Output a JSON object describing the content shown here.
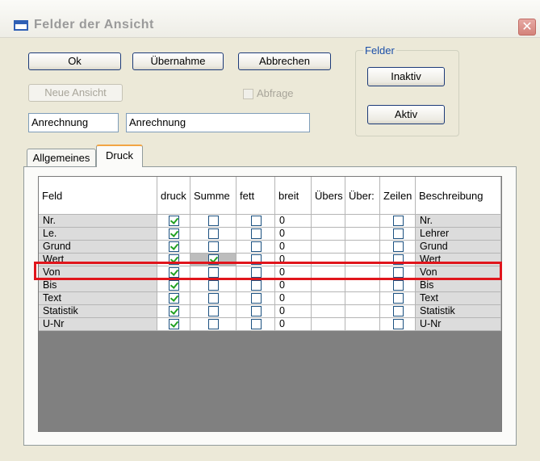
{
  "window": {
    "title": "Felder der Ansicht",
    "close_symbol": "✕"
  },
  "buttons": {
    "ok": "Ok",
    "uebernahme": "Übernahme",
    "abbrechen": "Abbrechen",
    "neue_ansicht": "Neue Ansicht",
    "inaktiv": "Inaktiv",
    "aktiv": "Aktiv"
  },
  "abfrage": {
    "label": "Abfrage",
    "checked": false,
    "enabled": false
  },
  "fields": {
    "short_name": "Anrechnung",
    "long_name": "Anrechnung"
  },
  "groupbox": {
    "title": "Felder"
  },
  "tabs": [
    {
      "label": "Allgemeines",
      "active": false
    },
    {
      "label": "Druck",
      "active": true
    }
  ],
  "grid": {
    "columns": [
      "Feld",
      "druck",
      "Summe",
      "fett",
      "breit",
      "Übers",
      "Über:",
      "Zeilen",
      "Beschreibung"
    ],
    "rows": [
      {
        "feld": "Nr.",
        "druck": true,
        "summe": false,
        "fett": false,
        "breit": "0",
        "zeilen": false,
        "beschreibung": "Nr."
      },
      {
        "feld": "Le.",
        "druck": true,
        "summe": false,
        "fett": false,
        "breit": "0",
        "zeilen": false,
        "beschreibung": "Lehrer"
      },
      {
        "feld": "Grund",
        "druck": true,
        "summe": false,
        "fett": false,
        "breit": "0",
        "zeilen": false,
        "beschreibung": "Grund"
      },
      {
        "feld": "Wert",
        "druck": true,
        "summe": true,
        "fett": false,
        "breit": "0",
        "zeilen": false,
        "beschreibung": "Wert",
        "highlighted": true
      },
      {
        "feld": "Von",
        "druck": true,
        "summe": false,
        "fett": false,
        "breit": "0",
        "zeilen": false,
        "beschreibung": "Von"
      },
      {
        "feld": "Bis",
        "druck": true,
        "summe": false,
        "fett": false,
        "breit": "0",
        "zeilen": false,
        "beschreibung": "Bis"
      },
      {
        "feld": "Text",
        "druck": true,
        "summe": false,
        "fett": false,
        "breit": "0",
        "zeilen": false,
        "beschreibung": "Text"
      },
      {
        "feld": "Statistik",
        "druck": true,
        "summe": false,
        "fett": false,
        "breit": "0",
        "zeilen": false,
        "beschreibung": "Statistik"
      },
      {
        "feld": "U-Nr",
        "druck": true,
        "summe": false,
        "fett": false,
        "breit": "0",
        "zeilen": false,
        "beschreibung": "U-Nr"
      }
    ]
  },
  "colors": {
    "highlight": "#e0151c",
    "check": "#21a121",
    "accent": "#1b4fa8"
  }
}
